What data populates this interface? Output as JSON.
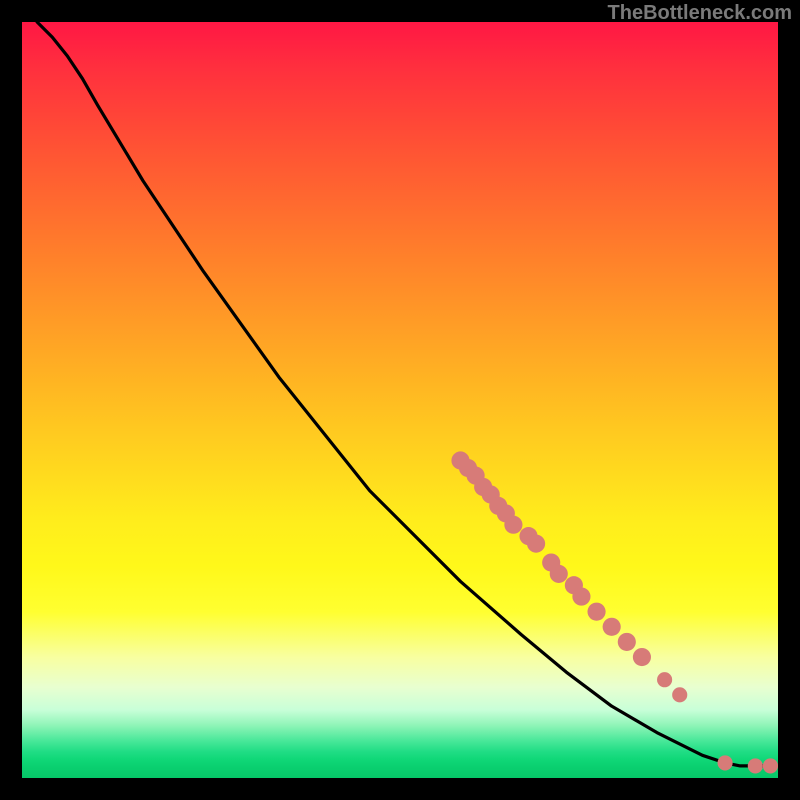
{
  "watermark": "TheBottleneck.com",
  "colors": {
    "curve_stroke": "#000000",
    "point_fill": "#d77b78"
  },
  "chart_data": {
    "type": "line",
    "title": "",
    "xlabel": "",
    "ylabel": "",
    "xlim": [
      0,
      100
    ],
    "ylim": [
      0,
      100
    ],
    "grid": false,
    "legend": false,
    "curve": [
      {
        "x": 2.0,
        "y": 100.0
      },
      {
        "x": 4.0,
        "y": 98.0
      },
      {
        "x": 6.0,
        "y": 95.5
      },
      {
        "x": 8.0,
        "y": 92.5
      },
      {
        "x": 10.0,
        "y": 89.0
      },
      {
        "x": 16.0,
        "y": 79.0
      },
      {
        "x": 24.0,
        "y": 67.0
      },
      {
        "x": 34.0,
        "y": 53.0
      },
      {
        "x": 46.0,
        "y": 38.0
      },
      {
        "x": 58.0,
        "y": 26.0
      },
      {
        "x": 66.0,
        "y": 19.0
      },
      {
        "x": 72.0,
        "y": 14.0
      },
      {
        "x": 78.0,
        "y": 9.5
      },
      {
        "x": 84.0,
        "y": 6.0
      },
      {
        "x": 90.0,
        "y": 3.0
      },
      {
        "x": 93.0,
        "y": 2.0
      },
      {
        "x": 95.0,
        "y": 1.6
      },
      {
        "x": 97.0,
        "y": 1.6
      },
      {
        "x": 99.0,
        "y": 1.6
      }
    ],
    "points": [
      {
        "x": 58.0,
        "y": 42.0,
        "r": 1.2
      },
      {
        "x": 59.0,
        "y": 41.0,
        "r": 1.2
      },
      {
        "x": 60.0,
        "y": 40.0,
        "r": 1.2
      },
      {
        "x": 61.0,
        "y": 38.5,
        "r": 1.2
      },
      {
        "x": 62.0,
        "y": 37.5,
        "r": 1.2
      },
      {
        "x": 63.0,
        "y": 36.0,
        "r": 1.2
      },
      {
        "x": 64.0,
        "y": 35.0,
        "r": 1.2
      },
      {
        "x": 65.0,
        "y": 33.5,
        "r": 1.2
      },
      {
        "x": 67.0,
        "y": 32.0,
        "r": 1.2
      },
      {
        "x": 68.0,
        "y": 31.0,
        "r": 1.2
      },
      {
        "x": 70.0,
        "y": 28.5,
        "r": 1.2
      },
      {
        "x": 71.0,
        "y": 27.0,
        "r": 1.2
      },
      {
        "x": 73.0,
        "y": 25.5,
        "r": 1.2
      },
      {
        "x": 74.0,
        "y": 24.0,
        "r": 1.2
      },
      {
        "x": 76.0,
        "y": 22.0,
        "r": 1.2
      },
      {
        "x": 78.0,
        "y": 20.0,
        "r": 1.2
      },
      {
        "x": 80.0,
        "y": 18.0,
        "r": 1.2
      },
      {
        "x": 82.0,
        "y": 16.0,
        "r": 1.2
      },
      {
        "x": 85.0,
        "y": 13.0,
        "r": 1.0
      },
      {
        "x": 87.0,
        "y": 11.0,
        "r": 1.0
      },
      {
        "x": 93.0,
        "y": 2.0,
        "r": 1.0
      },
      {
        "x": 97.0,
        "y": 1.6,
        "r": 1.0
      },
      {
        "x": 99.0,
        "y": 1.6,
        "r": 1.0
      }
    ]
  }
}
